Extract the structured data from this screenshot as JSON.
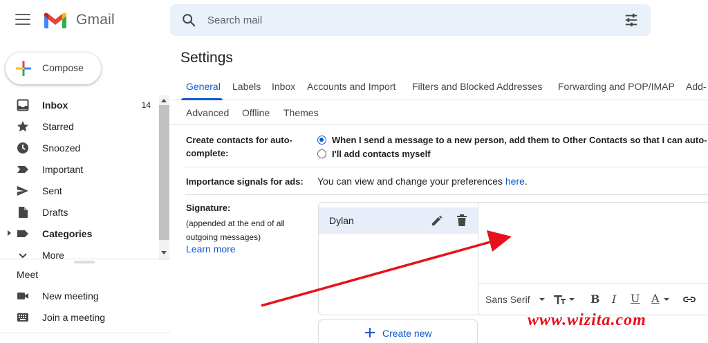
{
  "app": {
    "name": "Gmail"
  },
  "colors": {
    "accent": "#0b57d0",
    "arrow": "#e8101a",
    "selected_sig_bg": "#e8eef9"
  },
  "search": {
    "placeholder": "Search mail"
  },
  "sidebar": {
    "compose_label": "Compose",
    "items": [
      {
        "label": "Inbox",
        "count": "14",
        "icon": "inbox-icon"
      },
      {
        "label": "Starred",
        "icon": "star-icon"
      },
      {
        "label": "Snoozed",
        "icon": "clock-icon"
      },
      {
        "label": "Important",
        "icon": "important-icon"
      },
      {
        "label": "Sent",
        "icon": "send-icon"
      },
      {
        "label": "Drafts",
        "icon": "draft-icon"
      },
      {
        "label": "Categories",
        "icon": "label-icon"
      },
      {
        "label": "More",
        "icon": "chevron-down-icon"
      }
    ],
    "meet": {
      "title": "Meet",
      "new_meeting": "New meeting",
      "join_meeting": "Join a meeting"
    }
  },
  "settings": {
    "title": "Settings",
    "tabs": [
      "General",
      "Labels",
      "Inbox",
      "Accounts and Import",
      "Filters and Blocked Addresses",
      "Forwarding and POP/IMAP",
      "Add-"
    ],
    "tabs_row2": [
      "Advanced",
      "Offline",
      "Themes"
    ],
    "create_contacts": {
      "label_line1": "Create contacts for auto-",
      "label_line2": "complete:",
      "option1": "When I send a message to a new person, add them to Other Contacts so that I can auto-",
      "option2": "I'll add contacts myself"
    },
    "importance": {
      "label": "Importance signals for ads:",
      "text": "You can view and change your preferences ",
      "link": "here",
      "period": "."
    },
    "signature": {
      "label": "Signature:",
      "sub_line1": "(appended at the end of all",
      "sub_line2": "outgoing messages)",
      "learn_more": "Learn more",
      "name": "Dylan",
      "font": "Sans Serif",
      "create_new": "Create new"
    }
  },
  "watermark": "www.wizita.com"
}
